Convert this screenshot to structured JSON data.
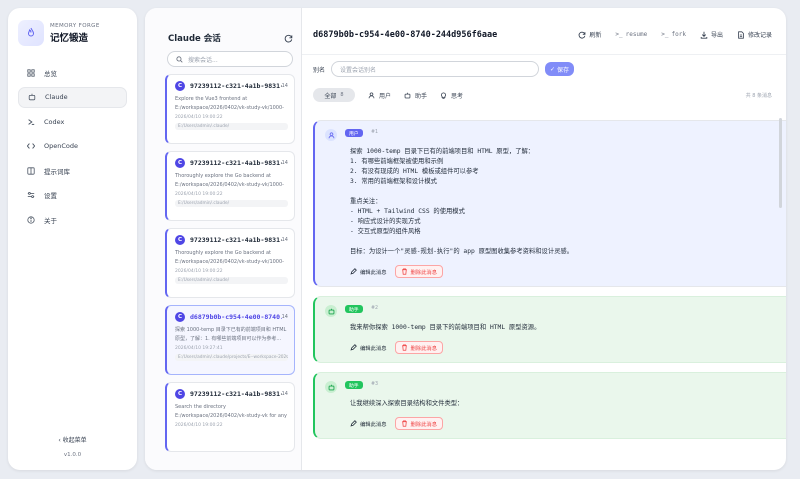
{
  "brand": {
    "subtitle": "MEMORY FORGE",
    "title": "记忆锻造"
  },
  "nav": {
    "items": [
      {
        "label": "总览",
        "icon": "grid-icon"
      },
      {
        "label": "Claude",
        "icon": "robot-icon"
      },
      {
        "label": "Codex",
        "icon": "chevron-right-icon"
      },
      {
        "label": "OpenCode",
        "icon": "code-icon"
      },
      {
        "label": "提示词库",
        "icon": "book-icon"
      },
      {
        "label": "设置",
        "icon": "sliders-icon"
      },
      {
        "label": "关于",
        "icon": "info-icon"
      }
    ],
    "collapse_label": "收起菜单",
    "version": "v1.0.0"
  },
  "sessions": {
    "title": "Claude 会话",
    "search_placeholder": "搜索会话...",
    "items": [
      {
        "id": "97239112-c321-4a1b-9831-1...",
        "count": "14",
        "desc": "Explore the Vue3 frontend at E:/workspace/2026/0402/vk-study-vk/1000-temp/ga-pure-admin",
        "time": "2026/04/10 19:00:22",
        "path": "E:/Users/admin/.claude/"
      },
      {
        "id": "97239112-c321-4a1b-9831-1...",
        "count": "14",
        "desc": "Thoroughly explore the Go backend at E:/workspace/2026/0402/vk-study-vk/1000-temp/vl_...",
        "time": "2026/04/10 19:00:22",
        "path": "E:/Users/admin/.claude/"
      },
      {
        "id": "97239112-c321-4a1b-9831-1...",
        "count": "14",
        "desc": "Thoroughly explore the Go backend at E:/workspace/2026/0402/vk-study-vk/1000-temp/go-...",
        "time": "2026/04/10 19:00:22",
        "path": "E:/Users/admin/.claude/"
      },
      {
        "id": "d6879b0b-c954-4e00-8740...",
        "count": "14",
        "desc": "探索 1000-temp 目录下已有的前端项目和 HTML 原型，了解：1. 有哪些前端项目可以作为参考...",
        "time": "2026/04/10 19:27:41",
        "path": "E:/Users/admin/.claude/projects/E--workspace-2026-0402-vk..."
      },
      {
        "id": "97239112-c321-4a1b-9831-1...",
        "count": "14",
        "desc": "Search the directory E:/workspace/2026/0402/vk-study-vk for any files related to \"harness\"...",
        "time": "2026/04/10 19:00:22",
        "path": "E:/Users/admin/.claude/"
      }
    ]
  },
  "detail": {
    "title": "d6879b0b-c954-4e00-8740-244d956f6aae",
    "actions": [
      {
        "label": "刷新",
        "icon": "refresh-icon"
      },
      {
        "label": "resume",
        "icon": "terminal-icon"
      },
      {
        "label": "fork",
        "icon": "terminal-icon"
      },
      {
        "label": "导出",
        "icon": "download-icon"
      },
      {
        "label": "修改记录",
        "icon": "file-icon"
      }
    ],
    "alias_label": "别名",
    "alias_placeholder": "设置会话别名",
    "save_label": "保存",
    "filters": {
      "all": "全部",
      "all_count": "8",
      "user": "用户",
      "assistant": "助手",
      "thinking": "思考"
    },
    "message_count": "共 8 条消息",
    "messages": [
      {
        "role": "用户",
        "type": "user",
        "num": "#1",
        "content": "探索 1000-temp 目录下已有的前端项目和 HTML 原型，了解：\n1. 有哪些前端框架被使用和示例\n2. 有没有现成的 HTML 模板或组件可以参考\n3. 常用的前端框架和设计模式\n\n重点关注：\n- HTML + Tailwind CSS 的使用模式\n- 响应式设计的实现方式\n- 交互式原型的组件风格\n\n目标：为设计一个\"灵感-规划-执行\"的 app 原型图收集参考资料和设计灵感。",
        "edit_label": "编辑此消息",
        "delete_label": "删除此消息"
      },
      {
        "role": "助手",
        "type": "assistant",
        "num": "#2",
        "content": "我来帮你探索 1000-temp 目录下的前端项目和 HTML 原型资源。",
        "edit_label": "编辑此消息",
        "delete_label": "删除此消息"
      },
      {
        "role": "助手",
        "type": "assistant",
        "num": "#3",
        "content": "让我继续深入探索目录结构和文件类型：",
        "edit_label": "编辑此消息",
        "delete_label": "删除此消息"
      }
    ]
  },
  "colors": {
    "accent": "#6366f1",
    "assistant": "#22c55e",
    "danger": "#ef4444"
  }
}
